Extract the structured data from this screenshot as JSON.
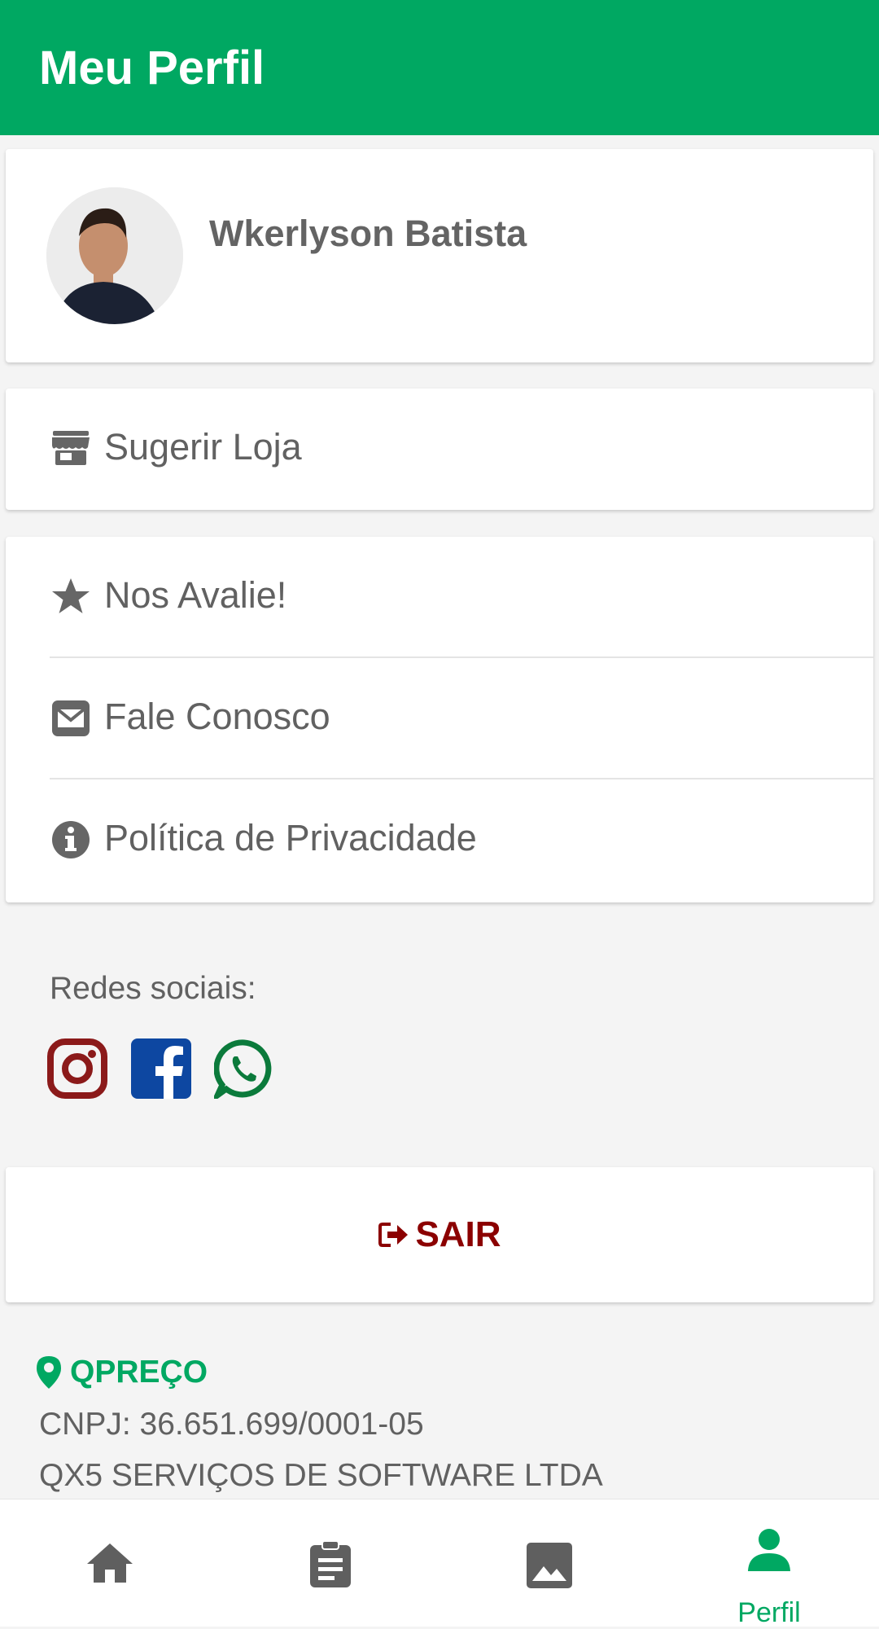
{
  "header": {
    "title": "Meu Perfil"
  },
  "profile": {
    "name": "Wkerlyson Batista"
  },
  "menu": {
    "suggest_store": "Sugerir Loja",
    "rate_us": "Nos Avalie!",
    "contact": "Fale Conosco",
    "privacy": "Política de Privacidade"
  },
  "social": {
    "title": "Redes sociais:",
    "icons": [
      "instagram-icon",
      "facebook-icon",
      "whatsapp-icon"
    ],
    "colors": {
      "instagram": "#8b1a1a",
      "facebook": "#0d47a1",
      "whatsapp": "#0b7a3b"
    }
  },
  "logout": {
    "label": "SAIR",
    "color": "#8b0000"
  },
  "footer": {
    "brand": "QPREÇO",
    "cnpj": "CNPJ: 36.651.699/0001-05",
    "company": "QX5 SERVIÇOS DE SOFTWARE LTDA"
  },
  "nav": {
    "items": [
      "home-icon",
      "clipboard-icon",
      "image-icon",
      "person-icon"
    ],
    "active_label": "Perfil"
  },
  "colors": {
    "primary": "#00a862",
    "text": "#616161"
  }
}
